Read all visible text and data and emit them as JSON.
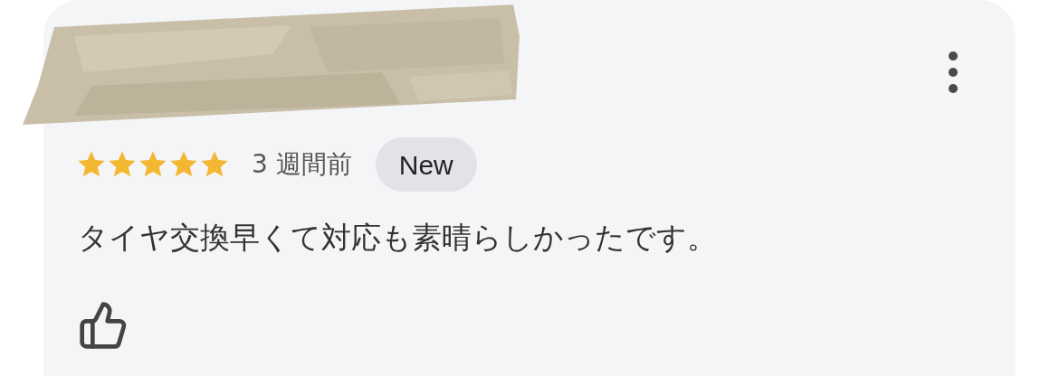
{
  "review": {
    "stars": 5,
    "time": "3 週間前",
    "badge": "New",
    "text": "タイヤ交換早くて対応も素晴らしかったです。"
  }
}
